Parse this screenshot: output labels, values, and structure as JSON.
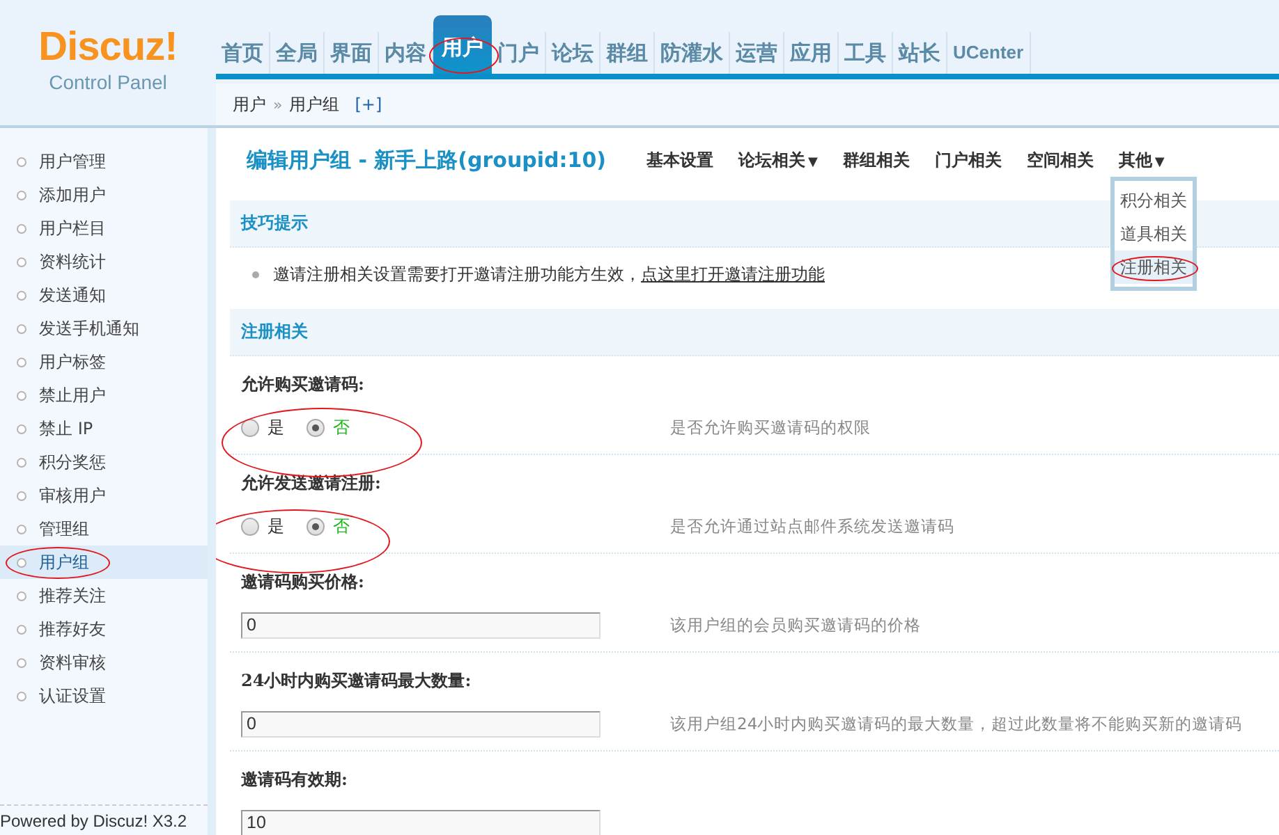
{
  "logo": {
    "brand": "Discuz!",
    "subtitle": "Control Panel"
  },
  "nav": [
    {
      "label": "首页",
      "selected": false,
      "circled": false
    },
    {
      "label": "全局",
      "selected": false,
      "circled": false
    },
    {
      "label": "界面",
      "selected": false,
      "circled": false
    },
    {
      "label": "内容",
      "selected": false,
      "circled": false
    },
    {
      "label": "用户",
      "selected": true,
      "circled": true
    },
    {
      "label": "门户",
      "selected": false,
      "circled": false
    },
    {
      "label": "论坛",
      "selected": false,
      "circled": false
    },
    {
      "label": "群组",
      "selected": false,
      "circled": false
    },
    {
      "label": "防灌水",
      "selected": false,
      "circled": false
    },
    {
      "label": "运营",
      "selected": false,
      "circled": false
    },
    {
      "label": "应用",
      "selected": false,
      "circled": false
    },
    {
      "label": "工具",
      "selected": false,
      "circled": false
    },
    {
      "label": "站长",
      "selected": false,
      "circled": false
    },
    {
      "label": "UCenter",
      "selected": false,
      "circled": false
    }
  ],
  "breadcrumb": {
    "items": [
      "用户",
      "用户组"
    ],
    "separator": "»",
    "add": "[+]"
  },
  "sidebar": {
    "items": [
      {
        "label": "用户管理",
        "selected": false,
        "circled": false
      },
      {
        "label": "添加用户",
        "selected": false,
        "circled": false
      },
      {
        "label": "用户栏目",
        "selected": false,
        "circled": false
      },
      {
        "label": "资料统计",
        "selected": false,
        "circled": false
      },
      {
        "label": "发送通知",
        "selected": false,
        "circled": false
      },
      {
        "label": "发送手机通知",
        "selected": false,
        "circled": false
      },
      {
        "label": "用户标签",
        "selected": false,
        "circled": false
      },
      {
        "label": "禁止用户",
        "selected": false,
        "circled": false
      },
      {
        "label": "禁止 IP",
        "selected": false,
        "circled": false
      },
      {
        "label": "积分奖惩",
        "selected": false,
        "circled": false
      },
      {
        "label": "审核用户",
        "selected": false,
        "circled": false
      },
      {
        "label": "管理组",
        "selected": false,
        "circled": false
      },
      {
        "label": "用户组",
        "selected": true,
        "circled": true
      },
      {
        "label": "推荐关注",
        "selected": false,
        "circled": false
      },
      {
        "label": "推荐好友",
        "selected": false,
        "circled": false
      },
      {
        "label": "资料审核",
        "selected": false,
        "circled": false
      },
      {
        "label": "认证设置",
        "selected": false,
        "circled": false
      }
    ],
    "footer": "Powered by Discuz! X3.2"
  },
  "page": {
    "title": "编辑用户组 - 新手上路(groupid:10)",
    "tabs": [
      {
        "label": "基本设置"
      },
      {
        "label": "论坛相关",
        "arrow": "▼"
      },
      {
        "label": "群组相关"
      },
      {
        "label": "门户相关"
      },
      {
        "label": "空间相关"
      },
      {
        "label": "其他",
        "arrow": "▼",
        "expanded": true,
        "menu": [
          {
            "label": "积分相关",
            "selected": false,
            "circled": false
          },
          {
            "label": "道具相关",
            "selected": false,
            "circled": false
          },
          {
            "label": "注册相关",
            "selected": true,
            "circled": true
          }
        ]
      }
    ]
  },
  "tips": {
    "title": "技巧提示",
    "text": "邀请注册相关设置需要打开邀请注册功能方生效，",
    "link": "点这里打开邀请注册功能"
  },
  "section": {
    "title": "注册相关"
  },
  "settings": [
    {
      "kind": "radio",
      "label": "允许购买邀请码:",
      "circled": true,
      "options": [
        {
          "label": "是",
          "selected": false
        },
        {
          "label": "否",
          "selected": true
        }
      ],
      "description": "是否允许购买邀请码的权限"
    },
    {
      "kind": "radio",
      "label": "允许发送邀请注册:",
      "circled": true,
      "options": [
        {
          "label": "是",
          "selected": false
        },
        {
          "label": "否",
          "selected": true
        }
      ],
      "description": "是否允许通过站点邮件系统发送邀请码"
    },
    {
      "kind": "text",
      "label": "邀请码购买价格:",
      "value": "0",
      "description": "该用户组的会员购买邀请码的价格"
    },
    {
      "kind": "text",
      "label": "24小时内购买邀请码最大数量:",
      "value": "0",
      "description": "该用户组24小时内购买邀请码的最大数量，超过此数量将不能购买新的邀请码"
    },
    {
      "kind": "text",
      "label": "邀请码有效期:",
      "value": "10"
    }
  ]
}
